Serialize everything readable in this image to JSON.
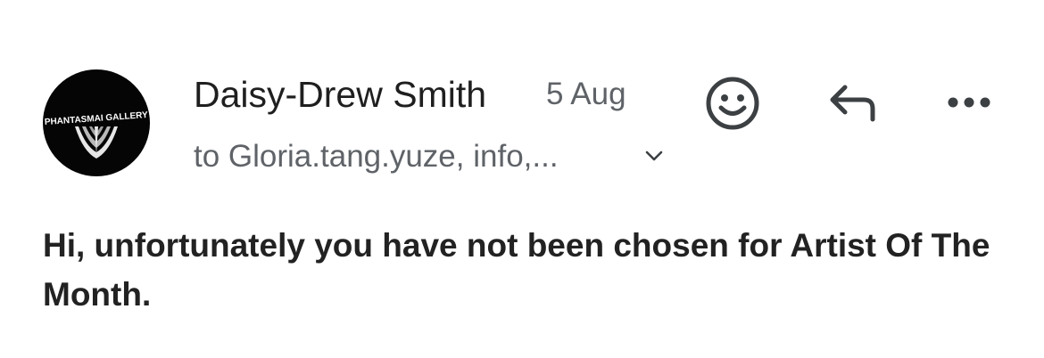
{
  "sender": {
    "avatar_text": "PHANTASMAI GALLERY",
    "name": "Daisy-Drew Smith",
    "date": "5 Aug"
  },
  "recipients": {
    "text": "to Gloria.tang.yuze, info,..."
  },
  "icons": {
    "expand": "chevron-down-icon",
    "emoji": "smiley-icon",
    "reply": "reply-icon",
    "more": "more-horizontal-icon"
  },
  "message": {
    "body": "Hi, unfortunately you have not been chosen for Artist Of The Month."
  },
  "colors": {
    "primary_text": "#1f1f1f",
    "secondary_text": "#5f6368",
    "avatar_bg": "#050505"
  }
}
